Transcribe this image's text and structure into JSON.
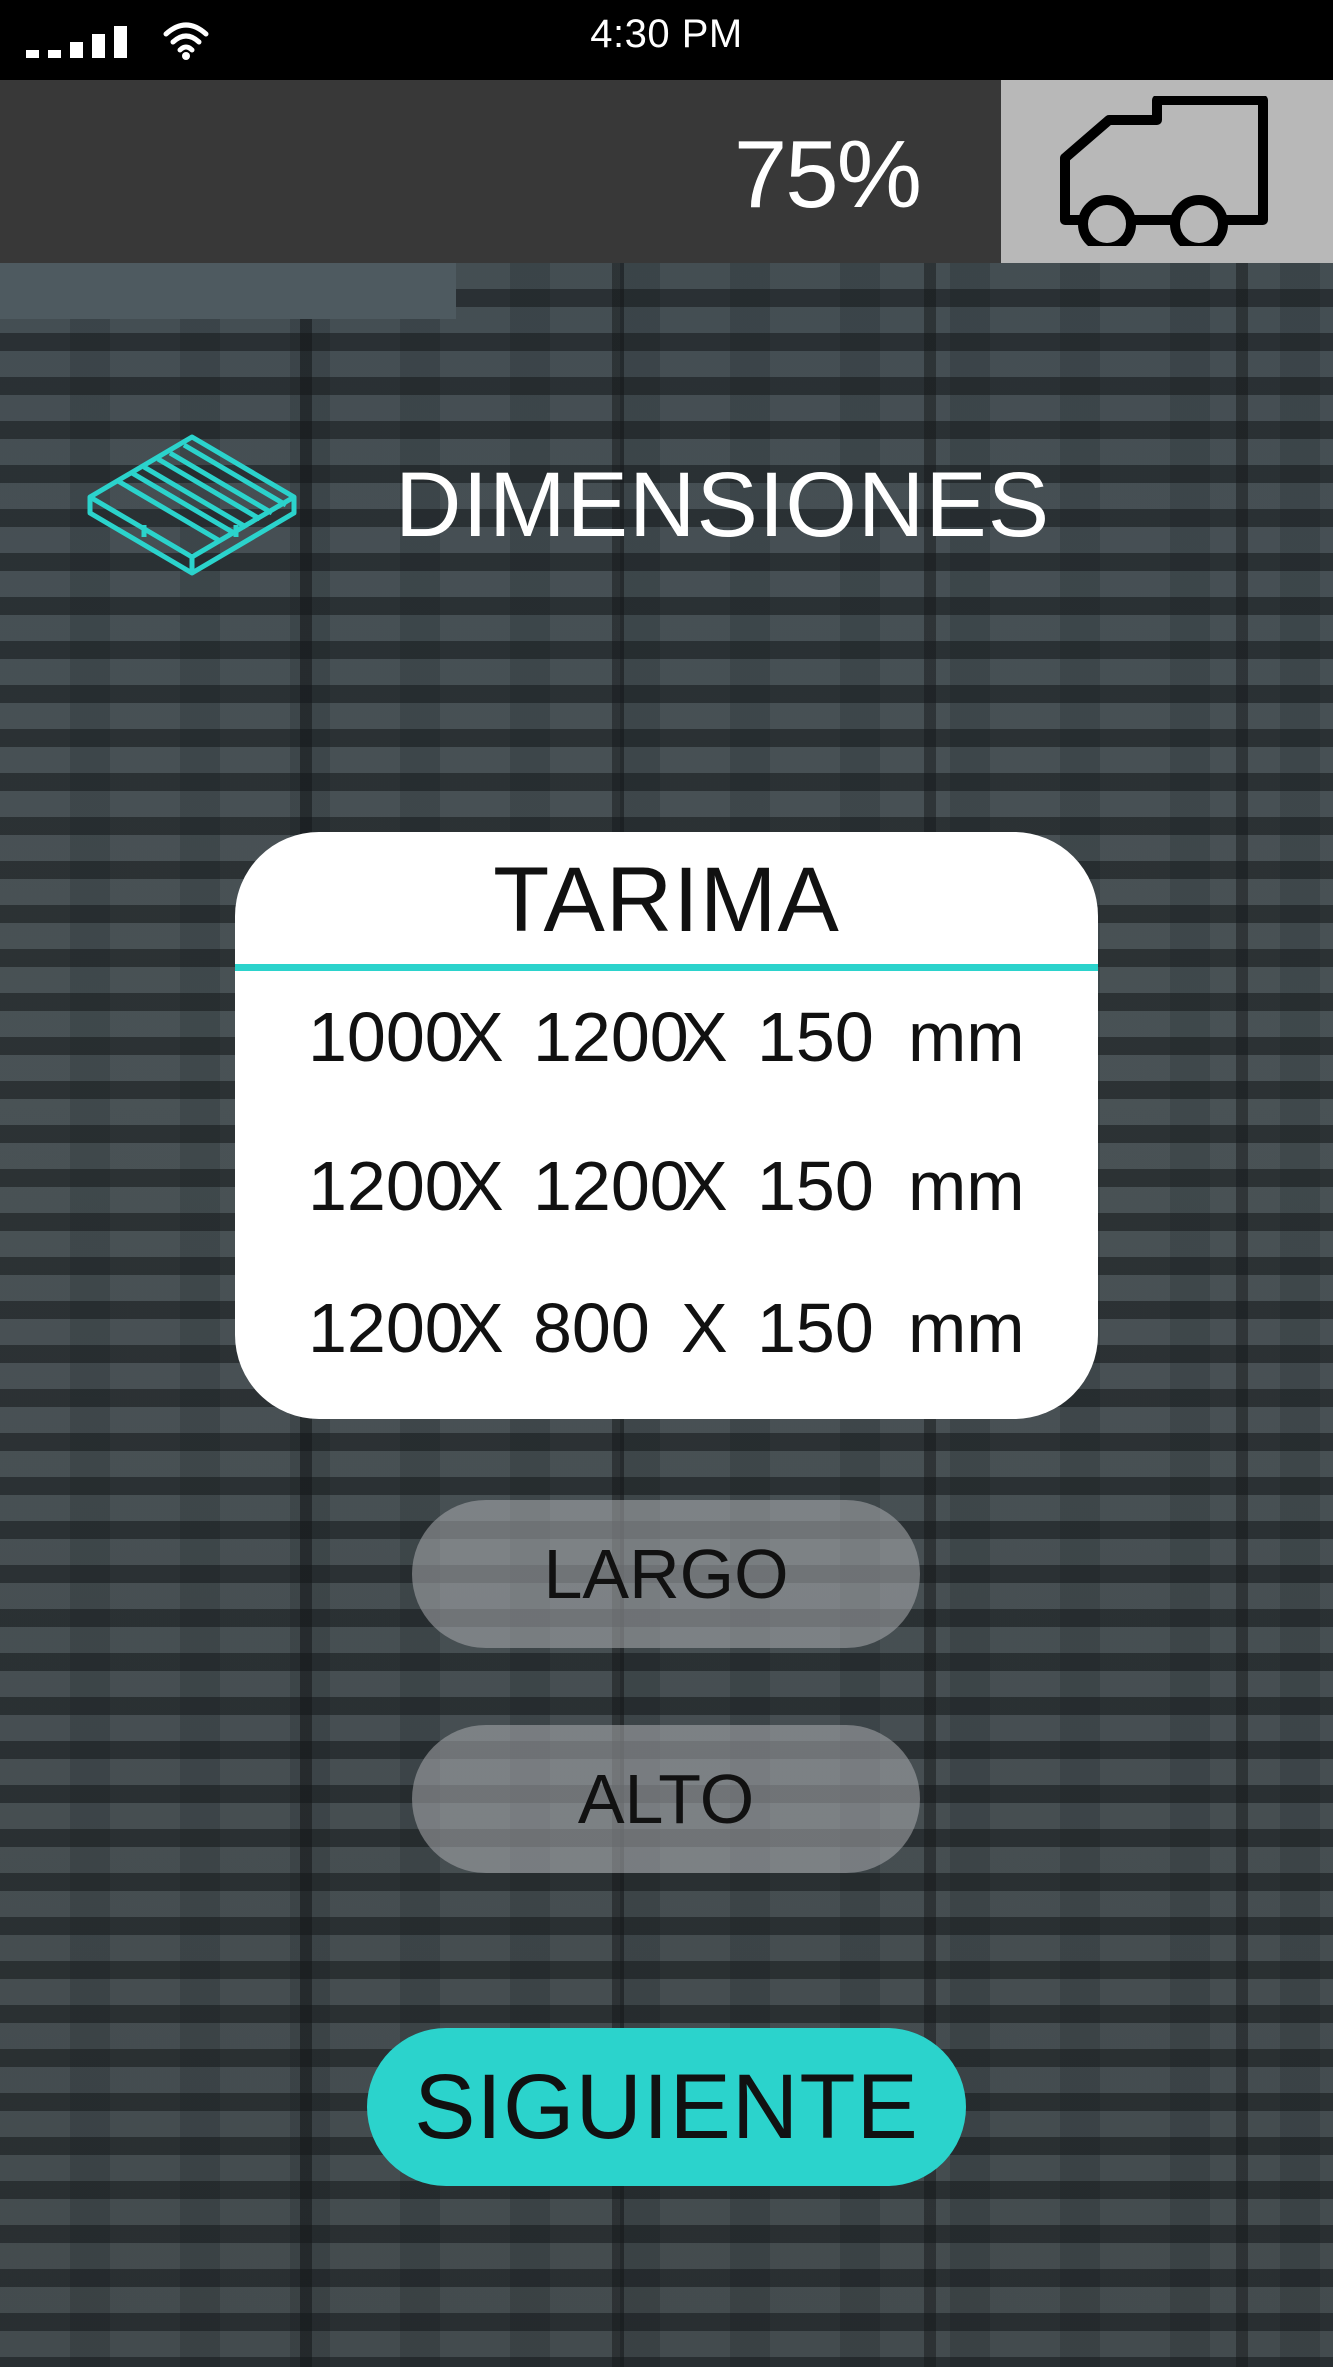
{
  "status_bar": {
    "time": "4:30 PM",
    "signal_icon": "signal-bars-icon",
    "wifi_icon": "wifi-icon"
  },
  "header": {
    "progress": "75%",
    "progress_value": 0.75,
    "truck_icon": "truck-icon",
    "truck_box_color": "#b8b8b8"
  },
  "section": {
    "icon": "pallet-icon",
    "title": "DIMENSIONES"
  },
  "card": {
    "title": "TARIMA",
    "accent_color": "#2bd3cc",
    "rows": [
      {
        "a": "1000",
        "x1": "X",
        "b": "1200",
        "x2": "X",
        "c": "150",
        "unit": "mm"
      },
      {
        "a": "1200",
        "x1": "X",
        "b": "1200",
        "x2": "X",
        "c": "150",
        "unit": "mm"
      },
      {
        "a": "1200",
        "x1": "X",
        "b": "800",
        "x2": "X",
        "c": "150",
        "unit": "mm"
      }
    ]
  },
  "options": {
    "largo": "LARGO",
    "alto": "ALTO"
  },
  "next_button": {
    "label": "SIGUIENTE",
    "color": "#2bd3cc"
  }
}
